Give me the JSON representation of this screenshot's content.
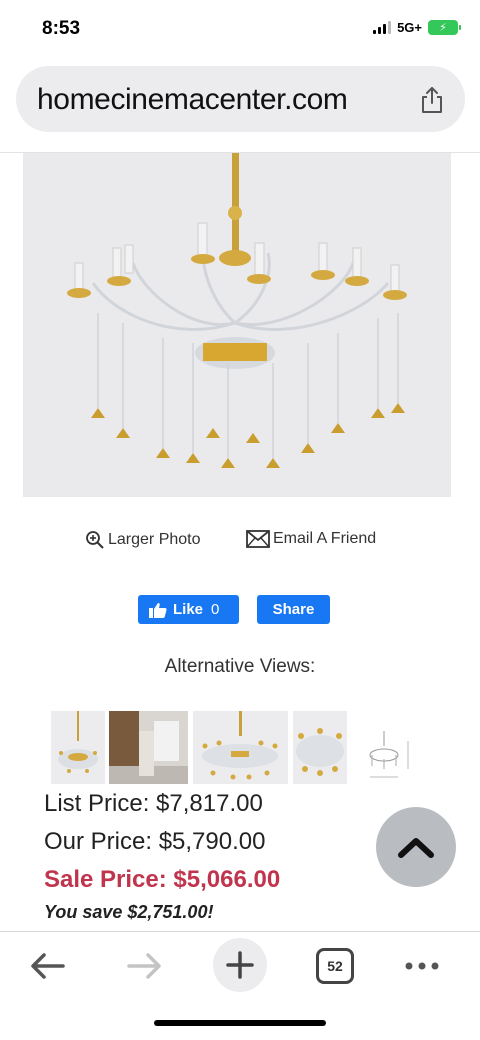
{
  "status_bar": {
    "time": "8:53",
    "network": "5G+",
    "battery_charging": true
  },
  "browser": {
    "url": "homecinemacenter.com"
  },
  "product": {
    "image_alt": "crystal chandelier with gold accents",
    "links": {
      "larger_photo": "Larger Photo",
      "email_friend": "Email A Friend"
    },
    "social": {
      "like_label": "Like",
      "like_count": "0",
      "share_label": "Share"
    },
    "alternative_views_label": "Alternative Views:",
    "thumbnails": [
      "chandelier-full",
      "living-room",
      "chandelier-wide",
      "chandelier-closeup",
      "dimension-drawing"
    ],
    "pricing": {
      "list_price": "List Price: $7,817.00",
      "our_price": "Our Price: $5,790.00",
      "sale_price": "Sale Price: $5,066.00",
      "you_save": "You save $2,751.00!"
    }
  },
  "toolbar": {
    "tab_count": "52"
  },
  "colors": {
    "facebook_blue": "#1877f2",
    "sale_red": "#c0344d",
    "battery_green": "#34c759"
  }
}
